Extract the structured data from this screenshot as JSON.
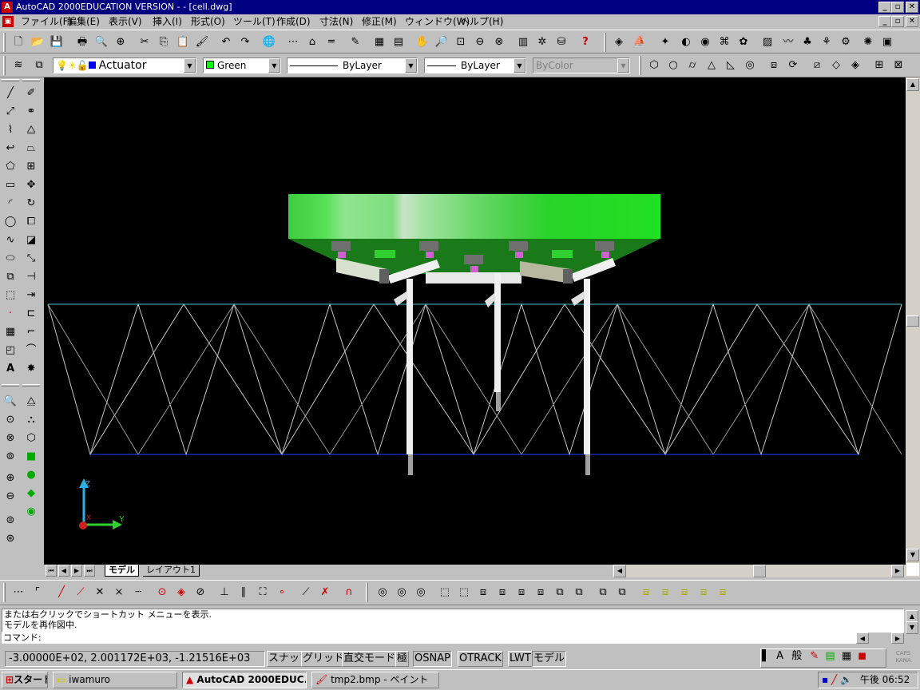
{
  "window": {
    "title": "AutoCAD 2000EDUCATION VERSION -  - [cell.dwg]",
    "app_icon": "autocad-icon",
    "doc_icon": "drawing-icon",
    "controls": [
      "_",
      "▫",
      "✕"
    ]
  },
  "menu": [
    {
      "label": "ファイル(F)"
    },
    {
      "label": "編集(E)"
    },
    {
      "label": "表示(V)"
    },
    {
      "label": "挿入(I)"
    },
    {
      "label": "形式(O)"
    },
    {
      "label": "ツール(T)"
    },
    {
      "label": "作成(D)"
    },
    {
      "label": "寸法(N)"
    },
    {
      "label": "修正(M)"
    },
    {
      "label": "ウィンドウ(W)"
    },
    {
      "label": "ヘルプ(H)"
    }
  ],
  "layer_toolbar": {
    "current_layer": "Actuator",
    "color": "Green",
    "color_swatch": "#00ff00",
    "linetype": "ByLayer",
    "lineweight": "ByLayer",
    "plotstyle": "ByColor"
  },
  "layout_tabs": [
    {
      "label": "モデル",
      "active": true
    },
    {
      "label": "レイアウト1",
      "active": false
    }
  ],
  "command": {
    "history": [
      "または右クリックでショートカット メニューを表示.",
      "モデルを再作図中."
    ],
    "prompt": "コマンド:"
  },
  "status": {
    "coordinates": "-3.00000E+02, 2.001172E+03, -1.21516E+03",
    "toggles": [
      {
        "label": "スナップ"
      },
      {
        "label": "グリッド"
      },
      {
        "label": "直交モード"
      },
      {
        "label": "極"
      },
      {
        "label": "OSNAP"
      },
      {
        "label": "OTRACK"
      },
      {
        "label": "LWT"
      },
      {
        "label": "モデル"
      }
    ]
  },
  "ucs": {
    "x": "X",
    "y": "Y",
    "z": "Z"
  },
  "taskbar": {
    "start": "スタート",
    "tasks": [
      {
        "label": "iwamuro",
        "icon": "folder-icon",
        "active": false
      },
      {
        "label": "AutoCAD 2000EDUC...",
        "icon": "autocad-icon",
        "active": true
      },
      {
        "label": "tmp2.bmp - ペイント",
        "icon": "paint-icon",
        "active": false
      }
    ],
    "clock": "午後 06:52"
  },
  "ime": {
    "mode": "A",
    "kanji": "般"
  }
}
